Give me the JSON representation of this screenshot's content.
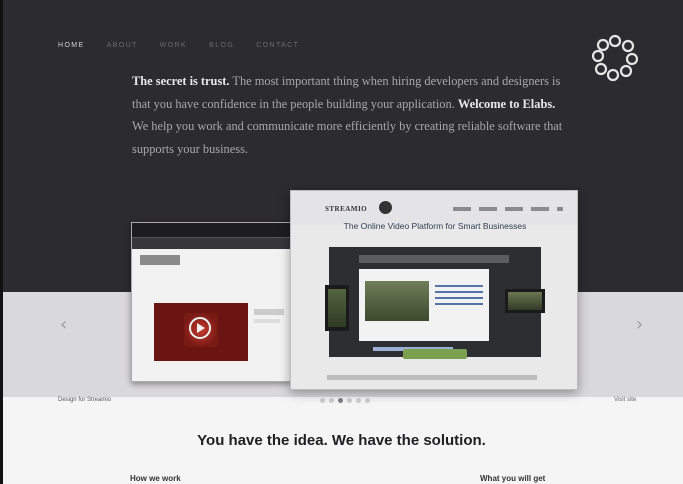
{
  "nav": {
    "items": [
      {
        "label": "HOME",
        "active": true
      },
      {
        "label": "ABOUT",
        "active": false
      },
      {
        "label": "WORK",
        "active": false
      },
      {
        "label": "BLOG",
        "active": false
      },
      {
        "label": "CONTACT",
        "active": false
      }
    ]
  },
  "intro": {
    "lead_bold": "The secret is trust.",
    "lead_text": " The most important thing when hiring developers and designers is that you have confidence in the people building your application.",
    "welcome_bold": "Welcome to Elabs.",
    "welcome_text": " We help you work and communicate more efficiently by creating reliable software that supports your business."
  },
  "carousel": {
    "mock_brand": "STREAMIO",
    "mock_tagline": "The Online Video Platform for Smart Businesses",
    "caption": "Design for Streamio",
    "visit_label": "Visit site",
    "dots_count": 6,
    "active_dot": 2
  },
  "section": {
    "headline": "You have the idea. We have the solution.",
    "col_left": "How we work",
    "col_right": "What you will get"
  },
  "colors": {
    "hero_bg": "#2c2b2f",
    "band_bg": "#d9d8db",
    "accent_green": "#7ba04f"
  },
  "icons": {
    "logo": "elabs-ring-logo-icon",
    "prev": "chevron-left-icon",
    "next": "chevron-right-icon"
  }
}
